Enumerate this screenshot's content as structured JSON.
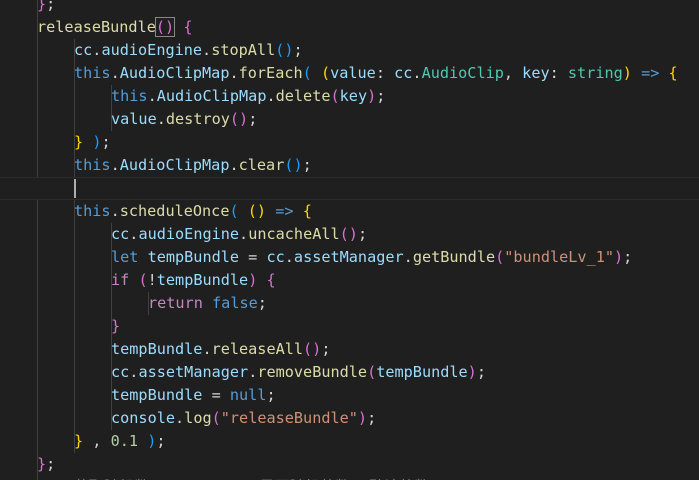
{
  "colors": {
    "background": "#1f1f1f",
    "function": "#dcdcaa",
    "variable": "#9cdcfe",
    "keyword": "#569cd6",
    "control": "#c586c0",
    "type": "#4ec9b0",
    "string": "#ce9178",
    "number": "#b5cea8",
    "bracket1": "#ffd700",
    "bracket2": "#da70d6",
    "bracket3": "#179fff",
    "comment": "#6a9955"
  },
  "code": {
    "lines": [
      [
        {
          "c": "b2",
          "t": "}"
        },
        {
          "c": "punc",
          "t": ";"
        }
      ],
      [
        {
          "c": "fn",
          "t": "releaseBundle"
        },
        {
          "c": "b2",
          "t": "()"
        },
        {
          "c": "punc",
          "t": " "
        },
        {
          "c": "b2",
          "t": "{"
        }
      ],
      [
        {
          "c": "var",
          "t": "cc"
        },
        {
          "c": "punc",
          "t": "."
        },
        {
          "c": "var",
          "t": "audioEngine"
        },
        {
          "c": "punc",
          "t": "."
        },
        {
          "c": "fn",
          "t": "stopAll"
        },
        {
          "c": "b3",
          "t": "()"
        },
        {
          "c": "punc",
          "t": ";"
        }
      ],
      [
        {
          "c": "this",
          "t": "this"
        },
        {
          "c": "punc",
          "t": "."
        },
        {
          "c": "var",
          "t": "AudioClipMap"
        },
        {
          "c": "punc",
          "t": "."
        },
        {
          "c": "fn",
          "t": "forEach"
        },
        {
          "c": "b3",
          "t": "("
        },
        {
          "c": "punc",
          "t": " "
        },
        {
          "c": "b1",
          "t": "("
        },
        {
          "c": "var",
          "t": "value"
        },
        {
          "c": "punc",
          "t": ": "
        },
        {
          "c": "var",
          "t": "cc"
        },
        {
          "c": "punc",
          "t": "."
        },
        {
          "c": "type",
          "t": "AudioClip"
        },
        {
          "c": "punc",
          "t": ", "
        },
        {
          "c": "var",
          "t": "key"
        },
        {
          "c": "punc",
          "t": ": "
        },
        {
          "c": "type",
          "t": "string"
        },
        {
          "c": "b1",
          "t": ")"
        },
        {
          "c": "punc",
          "t": " "
        },
        {
          "c": "kw",
          "t": "=>"
        },
        {
          "c": "punc",
          "t": " "
        },
        {
          "c": "b1",
          "t": "{"
        }
      ],
      [
        {
          "c": "this",
          "t": "this"
        },
        {
          "c": "punc",
          "t": "."
        },
        {
          "c": "var",
          "t": "AudioClipMap"
        },
        {
          "c": "punc",
          "t": "."
        },
        {
          "c": "fn",
          "t": "delete"
        },
        {
          "c": "b2",
          "t": "("
        },
        {
          "c": "var",
          "t": "key"
        },
        {
          "c": "b2",
          "t": ")"
        },
        {
          "c": "punc",
          "t": ";"
        }
      ],
      [
        {
          "c": "var",
          "t": "value"
        },
        {
          "c": "punc",
          "t": "."
        },
        {
          "c": "fn",
          "t": "destroy"
        },
        {
          "c": "b2",
          "t": "()"
        },
        {
          "c": "punc",
          "t": ";"
        }
      ],
      [
        {
          "c": "b1",
          "t": "}"
        },
        {
          "c": "punc",
          "t": " "
        },
        {
          "c": "b3",
          "t": ")"
        },
        {
          "c": "punc",
          "t": ";"
        }
      ],
      [
        {
          "c": "this",
          "t": "this"
        },
        {
          "c": "punc",
          "t": "."
        },
        {
          "c": "var",
          "t": "AudioClipMap"
        },
        {
          "c": "punc",
          "t": "."
        },
        {
          "c": "fn",
          "t": "clear"
        },
        {
          "c": "b3",
          "t": "()"
        },
        {
          "c": "punc",
          "t": ";"
        }
      ],
      [],
      [
        {
          "c": "this",
          "t": "this"
        },
        {
          "c": "punc",
          "t": "."
        },
        {
          "c": "fn",
          "t": "scheduleOnce"
        },
        {
          "c": "b3",
          "t": "("
        },
        {
          "c": "punc",
          "t": " "
        },
        {
          "c": "b1",
          "t": "()"
        },
        {
          "c": "punc",
          "t": " "
        },
        {
          "c": "kw",
          "t": "=>"
        },
        {
          "c": "punc",
          "t": " "
        },
        {
          "c": "b1",
          "t": "{"
        }
      ],
      [
        {
          "c": "var",
          "t": "cc"
        },
        {
          "c": "punc",
          "t": "."
        },
        {
          "c": "var",
          "t": "audioEngine"
        },
        {
          "c": "punc",
          "t": "."
        },
        {
          "c": "fn",
          "t": "uncacheAll"
        },
        {
          "c": "b2",
          "t": "()"
        },
        {
          "c": "punc",
          "t": ";"
        }
      ],
      [
        {
          "c": "kw",
          "t": "let"
        },
        {
          "c": "punc",
          "t": " "
        },
        {
          "c": "var",
          "t": "tempBundle"
        },
        {
          "c": "punc",
          "t": " = "
        },
        {
          "c": "var",
          "t": "cc"
        },
        {
          "c": "punc",
          "t": "."
        },
        {
          "c": "var",
          "t": "assetManager"
        },
        {
          "c": "punc",
          "t": "."
        },
        {
          "c": "fn",
          "t": "getBundle"
        },
        {
          "c": "b2",
          "t": "("
        },
        {
          "c": "str",
          "t": "\"bundleLv_1\""
        },
        {
          "c": "b2",
          "t": ")"
        },
        {
          "c": "punc",
          "t": ";"
        }
      ],
      [
        {
          "c": "ctrl",
          "t": "if"
        },
        {
          "c": "punc",
          "t": " "
        },
        {
          "c": "b2",
          "t": "("
        },
        {
          "c": "punc",
          "t": "!"
        },
        {
          "c": "var",
          "t": "tempBundle"
        },
        {
          "c": "b2",
          "t": ")"
        },
        {
          "c": "punc",
          "t": " "
        },
        {
          "c": "b2",
          "t": "{"
        }
      ],
      [
        {
          "c": "ctrl",
          "t": "return"
        },
        {
          "c": "punc",
          "t": " "
        },
        {
          "c": "kw",
          "t": "false"
        },
        {
          "c": "punc",
          "t": ";"
        }
      ],
      [
        {
          "c": "b2",
          "t": "}"
        }
      ],
      [
        {
          "c": "var",
          "t": "tempBundle"
        },
        {
          "c": "punc",
          "t": "."
        },
        {
          "c": "fn",
          "t": "releaseAll"
        },
        {
          "c": "b2",
          "t": "()"
        },
        {
          "c": "punc",
          "t": ";"
        }
      ],
      [
        {
          "c": "var",
          "t": "cc"
        },
        {
          "c": "punc",
          "t": "."
        },
        {
          "c": "var",
          "t": "assetManager"
        },
        {
          "c": "punc",
          "t": "."
        },
        {
          "c": "fn",
          "t": "removeBundle"
        },
        {
          "c": "b2",
          "t": "("
        },
        {
          "c": "var",
          "t": "tempBundle"
        },
        {
          "c": "b2",
          "t": ")"
        },
        {
          "c": "punc",
          "t": ";"
        }
      ],
      [
        {
          "c": "var",
          "t": "tempBundle"
        },
        {
          "c": "punc",
          "t": " = "
        },
        {
          "c": "kw",
          "t": "null"
        },
        {
          "c": "punc",
          "t": ";"
        }
      ],
      [
        {
          "c": "var",
          "t": "console"
        },
        {
          "c": "punc",
          "t": "."
        },
        {
          "c": "fn",
          "t": "log"
        },
        {
          "c": "b2",
          "t": "("
        },
        {
          "c": "str",
          "t": "\"releaseBundle\""
        },
        {
          "c": "b2",
          "t": ")"
        },
        {
          "c": "punc",
          "t": ";"
        }
      ],
      [
        {
          "c": "b1",
          "t": "}"
        },
        {
          "c": "punc",
          "t": " , "
        },
        {
          "c": "num",
          "t": "0.1"
        },
        {
          "c": "punc",
          "t": " "
        },
        {
          "c": "b3",
          "t": ")"
        },
        {
          "c": "punc",
          "t": ";"
        }
      ],
      [
        {
          "c": "b2",
          "t": "}"
        },
        {
          "c": "punc",
          "t": ";"
        }
      ],
      [
        {
          "c": "cmt",
          "t": "/** 获取随机数 min-Int -- 是否随机整数, 默认整数 */"
        }
      ]
    ]
  }
}
